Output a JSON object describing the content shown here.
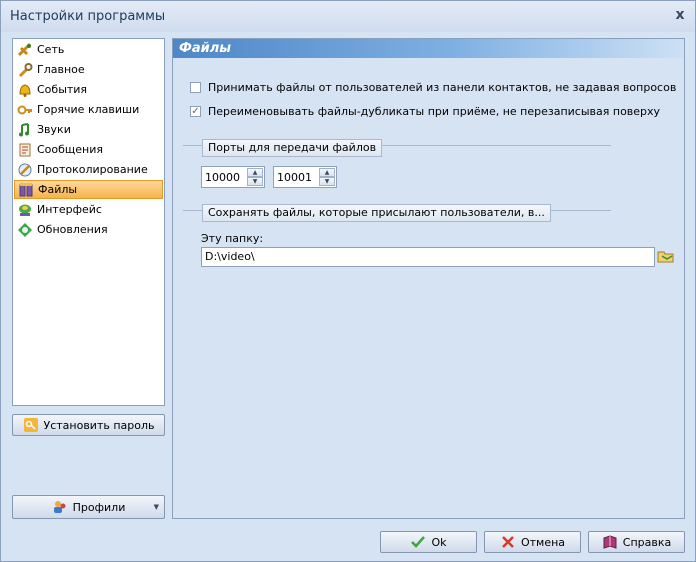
{
  "window": {
    "title": "Настройки программы",
    "close_label": "x"
  },
  "nav": {
    "items": [
      {
        "label": "Сеть",
        "icon": "network-icon"
      },
      {
        "label": "Главное",
        "icon": "wrench-icon"
      },
      {
        "label": "События",
        "icon": "bell-icon"
      },
      {
        "label": "Горячие клавиши",
        "icon": "key-icon"
      },
      {
        "label": "Звуки",
        "icon": "music-note-icon"
      },
      {
        "label": "Сообщения",
        "icon": "message-icon"
      },
      {
        "label": "Протоколирование",
        "icon": "log-icon"
      },
      {
        "label": "Файлы",
        "icon": "files-icon",
        "selected": true
      },
      {
        "label": "Интерфейс",
        "icon": "interface-icon"
      },
      {
        "label": "Обновления",
        "icon": "updates-icon"
      }
    ],
    "selected_color": "#f6b34b"
  },
  "buttons": {
    "set_password": "Установить пароль",
    "profiles": "Профили",
    "ok": "Ok",
    "cancel": "Отмена",
    "help": "Справка"
  },
  "panel": {
    "header": "Файлы",
    "checkbox_accept": {
      "label": "Принимать файлы от пользователей из панели контактов, не задавая вопросов",
      "checked": false
    },
    "checkbox_rename": {
      "label": "Переименовывать файлы-дубликаты при приёме, не перезаписывая поверху",
      "checked": true
    },
    "ports_group": "Порты для передачи файлов",
    "port_from": "10000",
    "port_to": "10001",
    "save_group": "Сохранять файлы, которые присылают пользователи, в...",
    "folder_label": "Эту папку:",
    "folder_value": "D:\\video\\"
  }
}
